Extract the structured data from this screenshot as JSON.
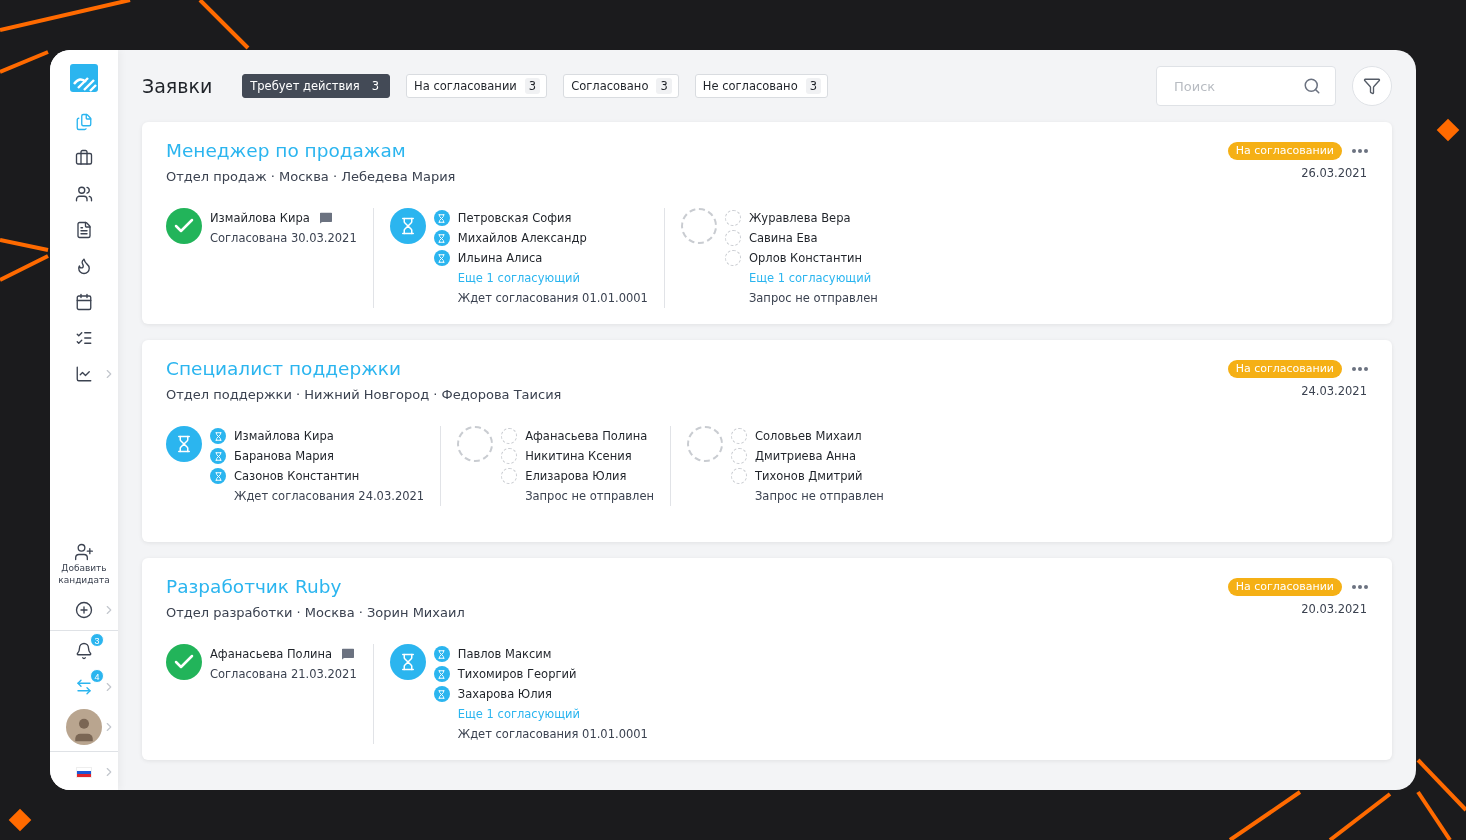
{
  "sidebar": {
    "nav": [
      {
        "kind": "documents",
        "selected": true,
        "submenu": false
      },
      {
        "kind": "briefcase",
        "selected": false,
        "submenu": false
      },
      {
        "kind": "people",
        "selected": false,
        "submenu": false
      },
      {
        "kind": "file",
        "selected": false,
        "submenu": false
      },
      {
        "kind": "flame",
        "selected": false,
        "submenu": false
      },
      {
        "kind": "calendar",
        "selected": false,
        "submenu": false
      },
      {
        "kind": "checklist",
        "selected": false,
        "submenu": false
      },
      {
        "kind": "chart",
        "selected": false,
        "submenu": true
      }
    ],
    "add_candidate": "Добавить кандидата",
    "notifications_badge": "3",
    "messages_badge": "4"
  },
  "header": {
    "title": "Заявки",
    "tabs": [
      {
        "label": "Требует действия",
        "count": "3",
        "selected": true
      },
      {
        "label": "На согласовании",
        "count": "3",
        "selected": false
      },
      {
        "label": "Согласовано",
        "count": "3",
        "selected": false
      },
      {
        "label": "Не согласовано",
        "count": "3",
        "selected": false
      }
    ],
    "search": {
      "placeholder": "Поиск"
    }
  },
  "cards": [
    {
      "title": "Менеджер по продажам",
      "subtitle": "Отдел продаж · Москва · Лебедева Мария",
      "status": "На согласовании",
      "date": "26.03.2021",
      "stages": [
        {
          "kind": "approved",
          "people": [
            {
              "name": "Измайлова Кира",
              "comment": true
            }
          ],
          "status": "Согласована 30.03.2021"
        },
        {
          "kind": "pending",
          "people": [
            {
              "name": "Петровская София"
            },
            {
              "name": "Михайлов Александр"
            },
            {
              "name": "Ильина Алиса"
            }
          ],
          "more": "Еще 1 согласующий",
          "status": "Ждет согласования 01.01.0001"
        },
        {
          "kind": "not_sent",
          "people": [
            {
              "name": "Журавлева Вера"
            },
            {
              "name": "Савина Ева"
            },
            {
              "name": "Орлов Константин"
            }
          ],
          "more": "Еще 1 согласующий",
          "status": "Запрос не отправлен"
        }
      ]
    },
    {
      "title": "Специалист поддержки",
      "subtitle": "Отдел поддержки · Нижний Новгород · Федорова Таисия",
      "status": "На согласовании",
      "date": "24.03.2021",
      "stages": [
        {
          "kind": "pending",
          "people": [
            {
              "name": "Измайлова Кира"
            },
            {
              "name": "Баранова Мария"
            },
            {
              "name": "Сазонов Константин"
            }
          ],
          "status": "Ждет согласования 24.03.2021"
        },
        {
          "kind": "not_sent",
          "people": [
            {
              "name": "Афанасьева Полина"
            },
            {
              "name": "Никитина Ксения"
            },
            {
              "name": "Елизарова Юлия"
            }
          ],
          "status": "Запрос не отправлен"
        },
        {
          "kind": "not_sent",
          "people": [
            {
              "name": "Соловьев Михаил"
            },
            {
              "name": "Дмитриева Анна"
            },
            {
              "name": "Тихонов Дмитрий"
            }
          ],
          "status": "Запрос не отправлен"
        }
      ]
    },
    {
      "title": "Разработчик Ruby",
      "subtitle": "Отдел разработки · Москва · Зорин Михаил",
      "status": "На согласовании",
      "date": "20.03.2021",
      "stages": [
        {
          "kind": "approved",
          "people": [
            {
              "name": "Афанасьева Полина",
              "comment": true
            }
          ],
          "status": "Согласована 21.03.2021"
        },
        {
          "kind": "pending",
          "people": [
            {
              "name": "Павлов Максим"
            },
            {
              "name": "Тихомиров Георгий"
            },
            {
              "name": "Захарова Юлия"
            }
          ],
          "more": "Еще 1 согласующий",
          "status": "Ждет согласования 01.01.0001"
        }
      ]
    }
  ]
}
